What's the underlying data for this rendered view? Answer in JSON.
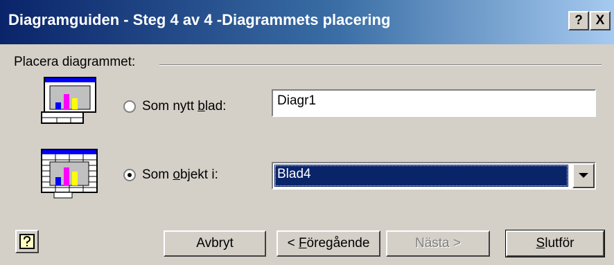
{
  "window": {
    "title": "Diagramguiden - Steg 4 av 4 -Diagrammets placering",
    "help_glyph": "?",
    "close_glyph": "X"
  },
  "placement": {
    "group_label": "Placera diagrammet:",
    "new_sheet": {
      "label_pre": "Som nytt ",
      "label_accel": "b",
      "label_post": "lad:",
      "selected": false,
      "value": "Diagr1"
    },
    "as_object": {
      "label_pre": "Som ",
      "label_accel": "o",
      "label_post": "bjekt i:",
      "selected": true,
      "value": "Blad4"
    }
  },
  "buttons": {
    "cancel": "Avbryt",
    "back_pre": "< ",
    "back_accel": "F",
    "back_post": "öregående",
    "next": "Nästa >",
    "finish_accel": "S",
    "finish_post": "lutför"
  },
  "colors": {
    "title_gradient_start": "#0a246a",
    "title_gradient_end": "#a6caf0",
    "selection": "#0a246a",
    "face": "#d4d0c8",
    "bar_blue": "#0000ff",
    "bar_magenta": "#ff00ff",
    "bar_yellow": "#ffff00"
  },
  "icons": [
    "chart-sheet-icon",
    "embedded-chart-icon",
    "help-icon",
    "dropdown-arrow-icon"
  ]
}
